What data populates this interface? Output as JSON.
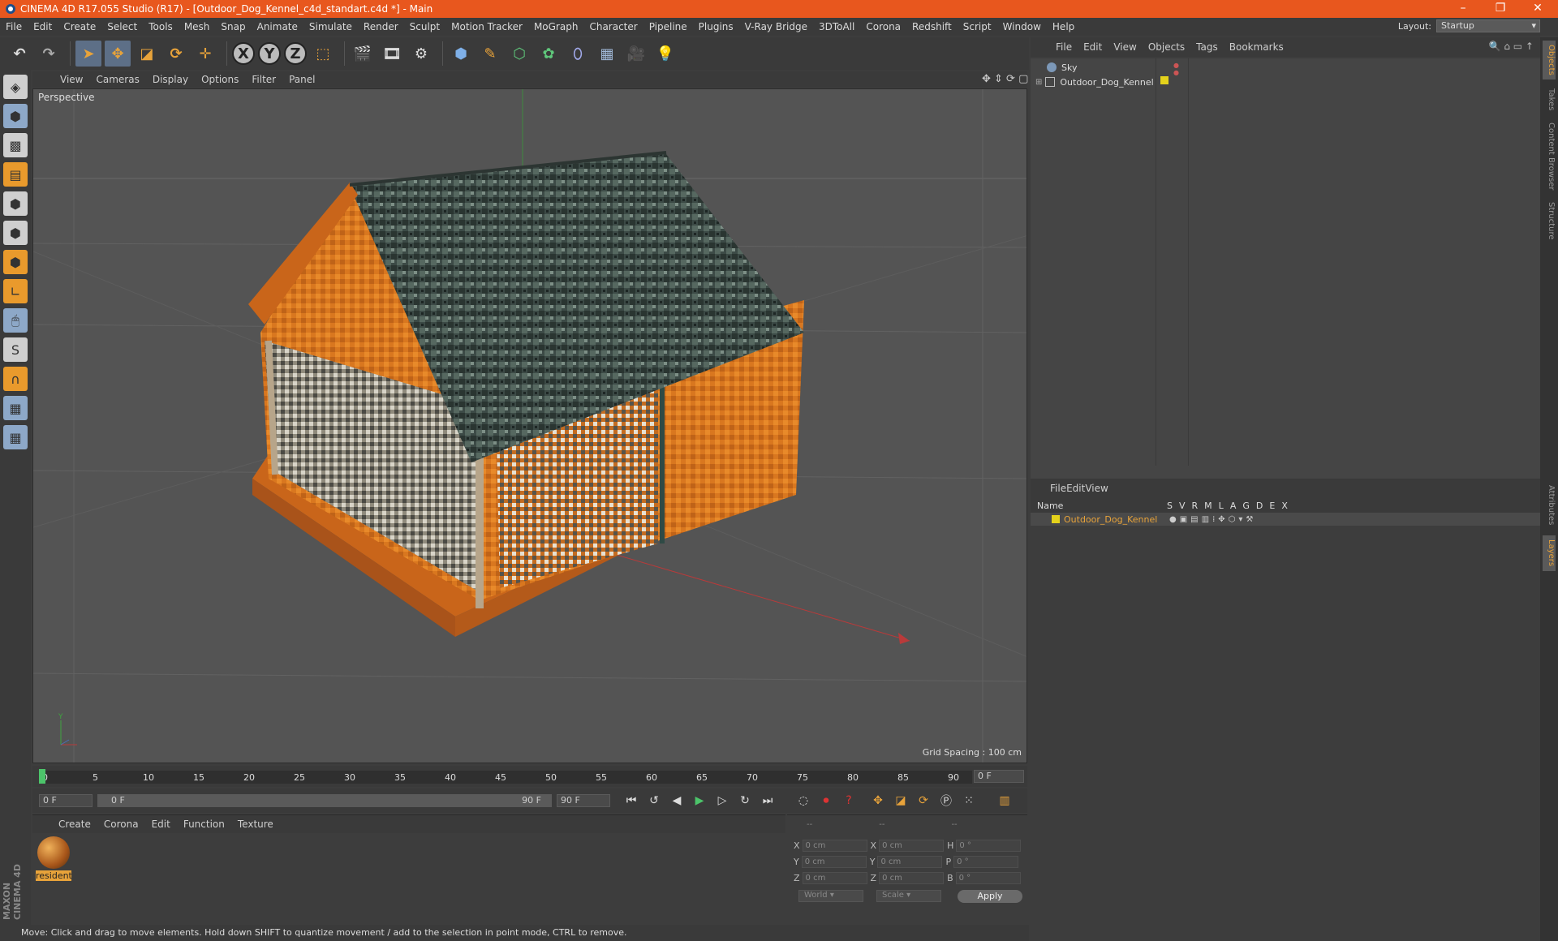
{
  "window": {
    "title": "CINEMA 4D R17.055 Studio (R17) - [Outdoor_Dog_Kennel_c4d_standart.c4d *] - Main"
  },
  "menubar": [
    "File",
    "Edit",
    "Create",
    "Select",
    "Tools",
    "Mesh",
    "Snap",
    "Animate",
    "Simulate",
    "Render",
    "Sculpt",
    "Motion Tracker",
    "MoGraph",
    "Character",
    "Pipeline",
    "Plugins",
    "V-Ray Bridge",
    "3DToAll",
    "Corona",
    "Redshift",
    "Script",
    "Window",
    "Help"
  ],
  "layout": {
    "label": "Layout:",
    "value": "Startup"
  },
  "toolbar": {
    "axis_x": "X",
    "axis_y": "Y",
    "axis_z": "Z"
  },
  "viewport": {
    "menu": [
      "View",
      "Cameras",
      "Display",
      "Options",
      "Filter",
      "Panel"
    ],
    "label": "Perspective",
    "grid_spacing": "Grid Spacing : 100 cm"
  },
  "timeline": {
    "ticks": [
      "0",
      "5",
      "10",
      "15",
      "20",
      "25",
      "30",
      "35",
      "40",
      "45",
      "50",
      "55",
      "60",
      "65",
      "70",
      "75",
      "80",
      "85",
      "90"
    ],
    "current_frame": "0 F",
    "start_field": "0 F",
    "range_start": "0 F",
    "range_end": "90 F",
    "end_field": "90 F"
  },
  "material_panel": {
    "menu": [
      "Create",
      "Corona",
      "Edit",
      "Function",
      "Texture"
    ],
    "material_name": "resident"
  },
  "coord_panel": {
    "headers": [
      "--",
      "--",
      "--"
    ],
    "rows": [
      {
        "a": "X",
        "av": "0 cm",
        "b": "X",
        "bv": "0 cm",
        "c": "H",
        "cv": "0 °"
      },
      {
        "a": "Y",
        "av": "0 cm",
        "b": "Y",
        "bv": "0 cm",
        "c": "P",
        "cv": "0 °"
      },
      {
        "a": "Z",
        "av": "0 cm",
        "b": "Z",
        "bv": "0 cm",
        "c": "B",
        "cv": "0 °"
      }
    ],
    "space": "World",
    "mode": "Scale",
    "apply": "Apply"
  },
  "object_manager": {
    "menu": [
      "File",
      "Edit",
      "View",
      "Objects",
      "Tags",
      "Bookmarks"
    ],
    "objects": [
      "Sky",
      "Outdoor_Dog_Kennel"
    ]
  },
  "layer_manager": {
    "menu": [
      "File",
      "Edit",
      "View"
    ],
    "columns": {
      "name": "Name",
      "flags": [
        "S",
        "V",
        "R",
        "M",
        "L",
        "A",
        "G",
        "D",
        "E",
        "X"
      ]
    },
    "layers": [
      "Outdoor_Dog_Kennel"
    ]
  },
  "right_tabs": [
    "Objects",
    "Takes",
    "Content Browser",
    "Structure",
    "Attributes",
    "Layers"
  ],
  "status": "Move: Click and drag to move elements. Hold down SHIFT to quantize movement / add to the selection in point mode, CTRL to remove.",
  "branding": "MAXON CINEMA 4D",
  "colors": {
    "titlebar": "#e8571e",
    "accent": "#e8a33a",
    "layer_color": "#e4d21b"
  }
}
